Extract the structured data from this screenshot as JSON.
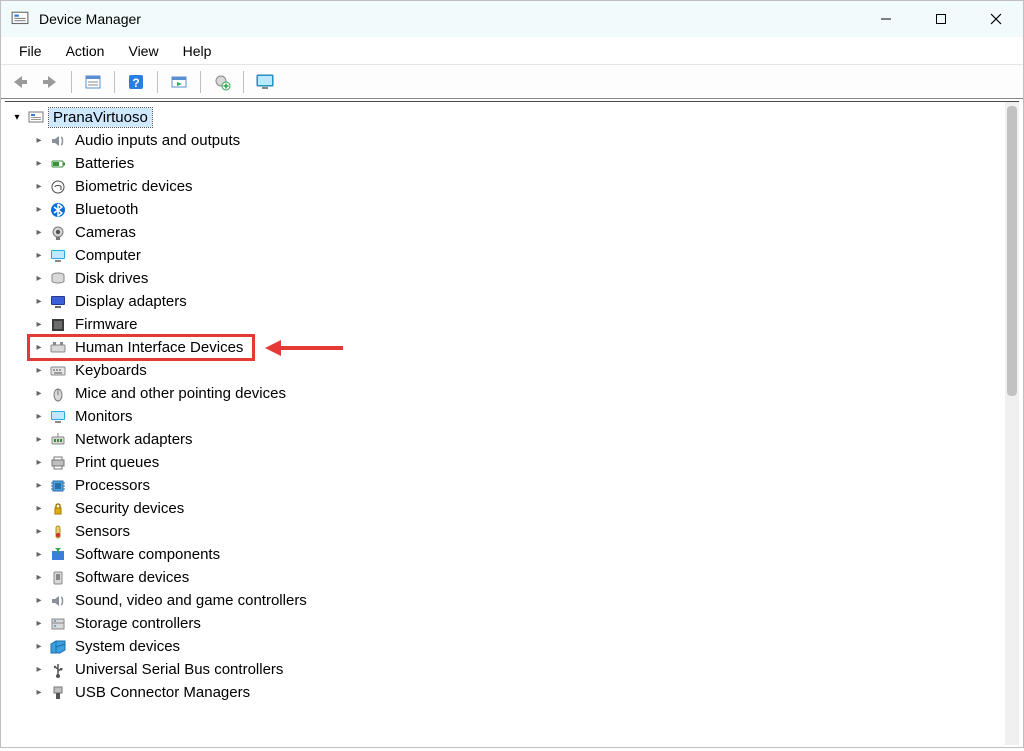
{
  "title": "Device Manager",
  "menu": {
    "file": "File",
    "action": "Action",
    "view": "View",
    "help": "Help"
  },
  "root": "PranaVirtuoso",
  "categories": [
    {
      "id": "audio",
      "label": "Audio inputs and outputs"
    },
    {
      "id": "batteries",
      "label": "Batteries"
    },
    {
      "id": "biometric",
      "label": "Biometric devices"
    },
    {
      "id": "bluetooth",
      "label": "Bluetooth"
    },
    {
      "id": "cameras",
      "label": "Cameras"
    },
    {
      "id": "computer",
      "label": "Computer"
    },
    {
      "id": "disk",
      "label": "Disk drives"
    },
    {
      "id": "display",
      "label": "Display adapters"
    },
    {
      "id": "firmware",
      "label": "Firmware"
    },
    {
      "id": "hid",
      "label": "Human Interface Devices"
    },
    {
      "id": "keyboards",
      "label": "Keyboards"
    },
    {
      "id": "mice",
      "label": "Mice and other pointing devices"
    },
    {
      "id": "monitors",
      "label": "Monitors"
    },
    {
      "id": "network",
      "label": "Network adapters"
    },
    {
      "id": "print",
      "label": "Print queues"
    },
    {
      "id": "processors",
      "label": "Processors"
    },
    {
      "id": "security",
      "label": "Security devices"
    },
    {
      "id": "sensors",
      "label": "Sensors"
    },
    {
      "id": "swcomp",
      "label": "Software components"
    },
    {
      "id": "swdev",
      "label": "Software devices"
    },
    {
      "id": "svgame",
      "label": "Sound, video and game controllers"
    },
    {
      "id": "storage",
      "label": "Storage controllers"
    },
    {
      "id": "system",
      "label": "System devices"
    },
    {
      "id": "usb",
      "label": "Universal Serial Bus controllers"
    },
    {
      "id": "usbconn",
      "label": "USB Connector Managers"
    }
  ],
  "highlight_id": "hid"
}
